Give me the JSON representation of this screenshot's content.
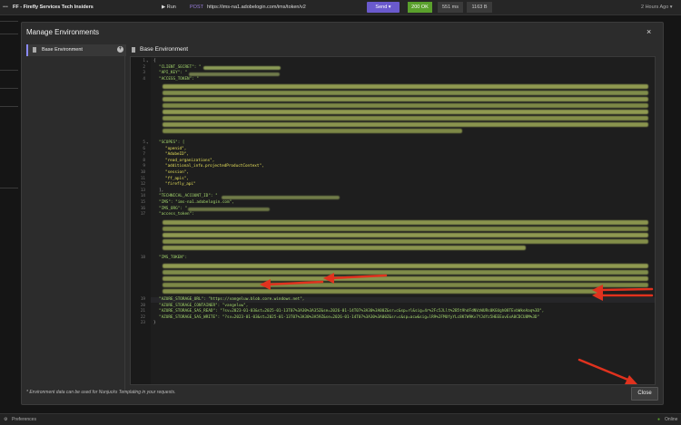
{
  "topbar": {
    "workspace": "FF - Firefly Services Tech Insiders",
    "run_label": "Run",
    "method": "POST",
    "url": "https://ims-na1.adobelogin.com/ims/token/v2",
    "send_label": "Send",
    "status": "200 OK",
    "time": "551 ms",
    "size": "1163 B",
    "ago": "2 Hours Ago"
  },
  "modal": {
    "title": "Manage Environments",
    "close_x": "×",
    "sidebar_item": "Base Environment",
    "editor_title": "Base Environment",
    "footnote": "* Environment data can be used for Nunjucks Templating in your requests.",
    "close_label": "Close"
  },
  "code": {
    "line_numbers": [
      "1",
      "2",
      "3",
      "4",
      "5",
      "6",
      "7",
      "8",
      "9",
      "10",
      "11",
      "12",
      "13",
      "14",
      "15",
      "16",
      "17",
      "18",
      "19",
      "20",
      "21",
      "22",
      "23"
    ],
    "lines": {
      "l1": "{",
      "l2": "\"CLIENT_SECRET\": \"",
      "l3": "\"API_KEY\": \"",
      "l4": "\"ACCESS_TOKEN\": \"",
      "l5": "\"SCOPES\": [",
      "l6": "\"openid\",",
      "l7": "\"AdobeID\",",
      "l8": "\"read_organizations\",",
      "l9": "\"additional_info.projectedProductContext\",",
      "l10": "\"session\",",
      "l11": "\"ff_apis\",",
      "l12": "\"firefly_api\"",
      "l13": "],",
      "l14": "\"TECHNICAL_ACCOUNT_ID\": \"",
      "l15": "\"IMS\": \"ims-na1.adobelogin.com\",",
      "l16": "\"IMS_ORG\": \"",
      "l17": "\"access_token\":",
      "l18": "\"IMS_TOKEN\":",
      "l19": "\"AZURE_STORAGE_URL\": \"https://vangeluw.blob.core.windows.net\",",
      "l20": "\"AZURE_STORAGE_CONTAINER\": \"vangeluw\",",
      "l21": "\"AZURE_STORAGE_SAS_READ\": \"?sv=2023-01-03&st=2025-01-13T07%3A30%3A35Z&se=2026-01-14T07%3A30%3A00Z&sr=c&sp=rl&sig=4r%2Fc5JLlt%2B5t9hdFdNVzWURs0KGUgh08TEvbWkeAaq%3D\",",
      "l22": "\"AZURE_STORAGE_SAS_WRITE\": \"?sv=2023-01-03&st=2025-01-13T07%3A30%3A59Z&se=2026-01-14T07%3A30%3A00Z&sr=c&sp=acw&sig=lR9%2FMUfyYLc8K7W9Kv7YJdYz5HEEEovExA0CDCU8M%3D\"",
      "l23": "}"
    }
  },
  "statusbar": {
    "preferences": "Preferences",
    "online": "Online"
  },
  "colors": {
    "accent": "#6a5acd",
    "status_ok": "#5aa02c",
    "arrow": "#e0321e",
    "json_key": "#a5d86e",
    "json_string": "#e6e05a"
  }
}
